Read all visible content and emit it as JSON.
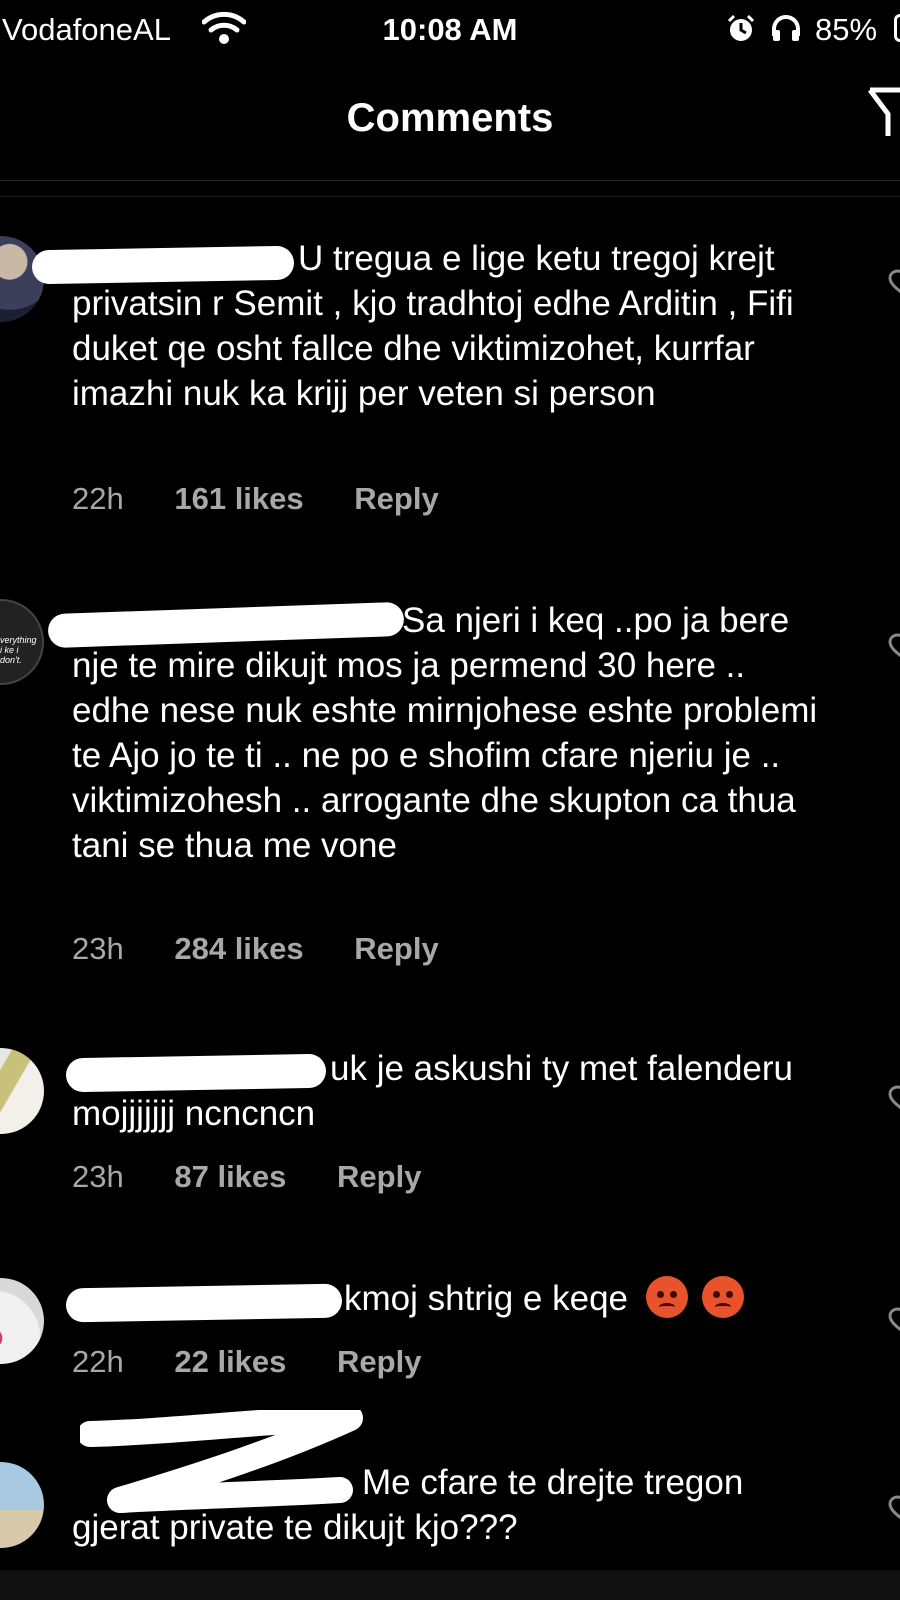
{
  "status_bar": {
    "carrier": "VodafoneAL",
    "time": "10:08 AM",
    "battery": "85%"
  },
  "header": {
    "title": "Comments"
  },
  "comments": [
    {
      "text": "U tregua e lige ketu tregoj krejt privatsin r Semit , kjo tradhtoj edhe Arditin , Fifi duket qe osht fallce dhe viktimizohet, kurrfar imazhi nuk ka krijj per veten si person",
      "time": "22h",
      "likes": "161 likes",
      "reply": "Reply"
    },
    {
      "text": "Sa njeri i keq ..po ja bere nje te mire dikujt mos ja permend 30 here .. edhe nese nuk eshte mirnjohese eshte problemi te Ajo jo te ti .. ne po e shofim cfare njeriu je .. viktimizohesh .. arrogante dhe skupton ca thua tani se thua me vone",
      "avatar_text": "verything i ke i don't.",
      "time": "23h",
      "likes": "284 likes",
      "reply": "Reply"
    },
    {
      "text": "uk je askushi ty met falenderu mojjjjjjj ncncncn",
      "time": "23h",
      "likes": "87 likes",
      "reply": "Reply"
    },
    {
      "text": "kmoj shtrig e keqe",
      "time": "22h",
      "likes": "22 likes",
      "reply": "Reply"
    },
    {
      "text": "Me cfare te drejte tregon gjerat private te dikujt kjo???"
    }
  ],
  "icons": [
    "wifi-icon",
    "alarm-icon",
    "headphones-icon",
    "battery-icon",
    "filter-icon",
    "heart-icon",
    "angry-face-emoji"
  ],
  "colors": {
    "background": "#000000",
    "text": "#ffffff",
    "meta": "#a8a8a8",
    "emoji": "#e8532c"
  }
}
